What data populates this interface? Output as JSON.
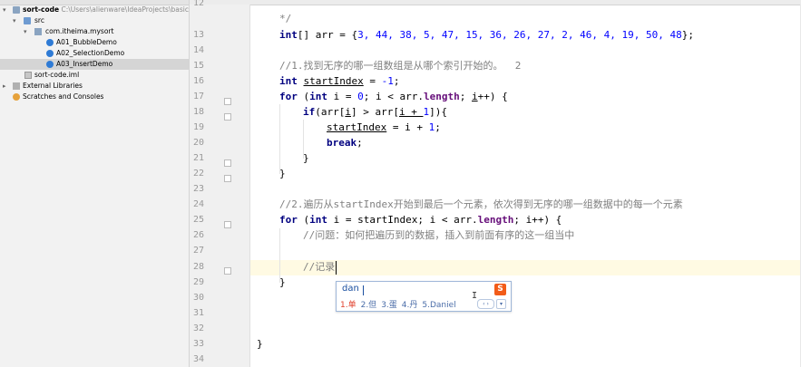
{
  "project_tree": {
    "root": {
      "name": "sort-code",
      "path": "C:\\Users\\alienware\\IdeaProjects\\basic-cod"
    },
    "src": "src",
    "package": "com.itheima.mysort",
    "classes": [
      "A01_BubbleDemo",
      "A02_SelectionDemo",
      "A03_InsertDemo"
    ],
    "selected_class": "A03_InsertDemo",
    "iml_file": "sort-code.iml",
    "external_libraries": "External Libraries",
    "scratches": "Scratches and Consoles"
  },
  "editor": {
    "line_numbers": [
      "12",
      "13",
      "14",
      "15",
      "16",
      "17",
      "18",
      "19",
      "20",
      "21",
      "22",
      "23",
      "24",
      "25",
      "26",
      "27",
      "28",
      "29",
      "30",
      "31",
      "32",
      "33",
      "34"
    ],
    "current_line": "28"
  },
  "code": {
    "l12": "*/",
    "l13_kw": "int",
    "l13_rest": "[] arr = {",
    "l13_nums": "3, 44, 38, 5, 47, 15, 36, 26, 27, 2, 46, 4, 19, 50, 48",
    "l13_end": "};",
    "l15": "//1.找到无序的哪一组数组是从哪个索引开始的。  2",
    "l16_kw": "int",
    "l16_var": "startIndex",
    "l16_eq": " = ",
    "l16_num": "-1",
    "l16_end": ";",
    "l17_kw1": "for",
    "l17_a": " (",
    "l17_kw2": "int",
    "l17_b": " i = ",
    "l17_num": "0",
    "l17_c": "; i < arr.",
    "l17_fld": "length",
    "l17_d": "; ",
    "l17_var": "i",
    "l17_e": "++) {",
    "l18_kw": "if",
    "l18_a": "(arr[",
    "l18_var1": "i",
    "l18_b": "] > arr[",
    "l18_var2": "i + ",
    "l18_num": "1",
    "l18_c": "]){",
    "l19_var": "startIndex",
    "l19_a": " = i + ",
    "l19_num": "1",
    "l19_b": ";",
    "l20_kw": "break",
    "l20_b": ";",
    "l21": "}",
    "l22": "}",
    "l24": "//2.遍历从startIndex开始到最后一个元素，依次得到无序的哪一组数据中的每一个元素",
    "l25_kw1": "for",
    "l25_a": " (",
    "l25_kw2": "int",
    "l25_b": " i = startIndex; i < arr.",
    "l25_fld": "length",
    "l25_c": "; i++) {",
    "l26": "//问题：如何把遍历到的数据，插入到前面有序的这一组当中",
    "l28": "//记录",
    "l29": "}",
    "l33": "}"
  },
  "ime": {
    "input": "dan",
    "logo": "S",
    "candidates": [
      "1.单",
      "2.但",
      "3.蛋",
      "4.丹",
      "5.Daniel"
    ],
    "pager": "‹ ›",
    "menu": "▾"
  },
  "colors": {
    "keyword": "#000080",
    "number": "#0000ff",
    "comment": "#808080",
    "field": "#660e7a",
    "current_line": "#fffae3",
    "ime_first_candidate": "#e0402c"
  }
}
